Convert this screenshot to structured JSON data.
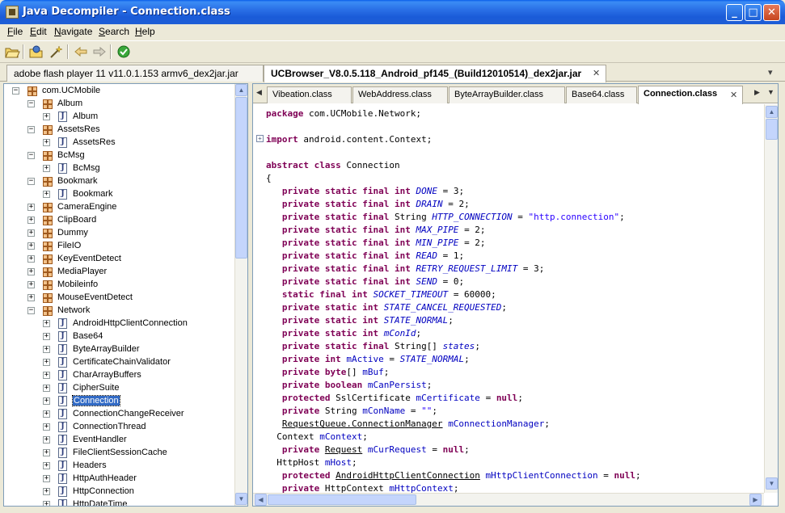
{
  "window": {
    "title": "Java Decompiler - Connection.class",
    "minimize": "_",
    "maximize": "□",
    "close": "✕"
  },
  "menu": {
    "items": [
      {
        "first": "F",
        "rest": "ile"
      },
      {
        "first": "E",
        "rest": "dit"
      },
      {
        "first": "N",
        "rest": "avigate"
      },
      {
        "first": "S",
        "rest": "earch"
      },
      {
        "first": "H",
        "rest": "elp"
      }
    ]
  },
  "toolbar": {
    "icons": [
      "open-folder-icon",
      "open-type-icon",
      "wand-icon",
      "back-arrow-icon",
      "forward-arrow-icon",
      "about-icon"
    ]
  },
  "jar_tabs": [
    {
      "label": "adobe flash player 11 v11.0.1.153 armv6_dex2jar.jar",
      "active": false
    },
    {
      "label": "UCBrowser_V8.0.5.118_Android_pf145_(Build12010514)_dex2jar.jar",
      "active": true
    }
  ],
  "tab_close": "✕",
  "tab_menu": "▾",
  "tree": {
    "expand": "+",
    "collapse": "−",
    "class_glyph": "J",
    "items": [
      {
        "label": "com.UCMobile",
        "type": "package",
        "level": 0,
        "state": "open"
      },
      {
        "label": "Album",
        "type": "package",
        "level": 1,
        "state": "open"
      },
      {
        "label": "Album",
        "type": "class",
        "level": 2,
        "state": "closed"
      },
      {
        "label": "AssetsRes",
        "type": "package",
        "level": 1,
        "state": "open"
      },
      {
        "label": "AssetsRes",
        "type": "class",
        "level": 2,
        "state": "closed"
      },
      {
        "label": "BcMsg",
        "type": "package",
        "level": 1,
        "state": "open"
      },
      {
        "label": "BcMsg",
        "type": "class",
        "level": 2,
        "state": "closed"
      },
      {
        "label": "Bookmark",
        "type": "package",
        "level": 1,
        "state": "open"
      },
      {
        "label": "Bookmark",
        "type": "class",
        "level": 2,
        "state": "closed"
      },
      {
        "label": "CameraEngine",
        "type": "package",
        "level": 1,
        "state": "closed"
      },
      {
        "label": "ClipBoard",
        "type": "package",
        "level": 1,
        "state": "closed"
      },
      {
        "label": "Dummy",
        "type": "package",
        "level": 1,
        "state": "closed"
      },
      {
        "label": "FileIO",
        "type": "package",
        "level": 1,
        "state": "closed"
      },
      {
        "label": "KeyEventDetect",
        "type": "package",
        "level": 1,
        "state": "closed"
      },
      {
        "label": "MediaPlayer",
        "type": "package",
        "level": 1,
        "state": "closed"
      },
      {
        "label": "Mobileinfo",
        "type": "package",
        "level": 1,
        "state": "closed"
      },
      {
        "label": "MouseEventDetect",
        "type": "package",
        "level": 1,
        "state": "closed"
      },
      {
        "label": "Network",
        "type": "package",
        "level": 1,
        "state": "open"
      },
      {
        "label": "AndroidHttpClientConnection",
        "type": "class",
        "level": 2,
        "state": "closed"
      },
      {
        "label": "Base64",
        "type": "class",
        "level": 2,
        "state": "closed"
      },
      {
        "label": "ByteArrayBuilder",
        "type": "class",
        "level": 2,
        "state": "closed"
      },
      {
        "label": "CertificateChainValidator",
        "type": "class",
        "level": 2,
        "state": "closed"
      },
      {
        "label": "CharArrayBuffers",
        "type": "class",
        "level": 2,
        "state": "closed"
      },
      {
        "label": "CipherSuite",
        "type": "class",
        "level": 2,
        "state": "closed"
      },
      {
        "label": "Connection",
        "type": "class",
        "level": 2,
        "state": "closed",
        "selected": true
      },
      {
        "label": "ConnectionChangeReceiver",
        "type": "class",
        "level": 2,
        "state": "closed"
      },
      {
        "label": "ConnectionThread",
        "type": "class",
        "level": 2,
        "state": "closed"
      },
      {
        "label": "EventHandler",
        "type": "class",
        "level": 2,
        "state": "closed"
      },
      {
        "label": "FileClientSessionCache",
        "type": "class",
        "level": 2,
        "state": "closed"
      },
      {
        "label": "Headers",
        "type": "class",
        "level": 2,
        "state": "closed"
      },
      {
        "label": "HttpAuthHeader",
        "type": "class",
        "level": 2,
        "state": "closed"
      },
      {
        "label": "HttpConnection",
        "type": "class",
        "level": 2,
        "state": "closed"
      },
      {
        "label": "HttpDateTime",
        "type": "class",
        "level": 2,
        "state": "closed"
      }
    ]
  },
  "class_tabs": [
    {
      "label": "Vibeation.class",
      "active": false
    },
    {
      "label": "WebAddress.class",
      "active": false
    },
    {
      "label": "ByteArrayBuilder.class",
      "active": false
    },
    {
      "label": "Base64.class",
      "active": false
    },
    {
      "label": "Connection.class",
      "active": true
    }
  ],
  "scroll_glyphs": {
    "up": "▲",
    "down": "▼",
    "left": "◀",
    "right": "▶",
    "tab_left": "◀",
    "tab_right": "▶"
  },
  "fold_marker": "+",
  "code": [
    [
      [
        "kw",
        "package"
      ],
      [
        "",
        "com.UCMobile.Network;"
      ]
    ],
    [],
    [
      [
        "kw",
        "import"
      ],
      [
        "",
        "android.content.Context;"
      ]
    ],
    [],
    [
      [
        "kw",
        "abstract class"
      ],
      [
        "",
        "Connection"
      ]
    ],
    [
      [
        "",
        "{"
      ]
    ],
    [
      [
        "",
        "  "
      ],
      [
        "kw",
        "private static final int"
      ],
      [
        "it",
        "DONE"
      ],
      [
        "",
        "= 3;"
      ]
    ],
    [
      [
        "",
        "  "
      ],
      [
        "kw",
        "private static final int"
      ],
      [
        "it",
        "DRAIN"
      ],
      [
        "",
        "= 2;"
      ]
    ],
    [
      [
        "",
        "  "
      ],
      [
        "kw",
        "private static final"
      ],
      [
        "",
        "String"
      ],
      [
        "it",
        "HTTP_CONNECTION"
      ],
      [
        "",
        "="
      ],
      [
        "str",
        "\"http.connection\""
      ],
      [
        "",
        ";"
      ]
    ],
    [
      [
        "",
        "  "
      ],
      [
        "kw",
        "private static final int"
      ],
      [
        "it",
        "MAX_PIPE"
      ],
      [
        "",
        "= 2;"
      ]
    ],
    [
      [
        "",
        "  "
      ],
      [
        "kw",
        "private static final int"
      ],
      [
        "it",
        "MIN_PIPE"
      ],
      [
        "",
        "= 2;"
      ]
    ],
    [
      [
        "",
        "  "
      ],
      [
        "kw",
        "private static final int"
      ],
      [
        "it",
        "READ"
      ],
      [
        "",
        "= 1;"
      ]
    ],
    [
      [
        "",
        "  "
      ],
      [
        "kw",
        "private static final int"
      ],
      [
        "it",
        "RETRY_REQUEST_LIMIT"
      ],
      [
        "",
        "= 3;"
      ]
    ],
    [
      [
        "",
        "  "
      ],
      [
        "kw",
        "private static final int"
      ],
      [
        "it",
        "SEND"
      ],
      [
        "",
        "= 0;"
      ]
    ],
    [
      [
        "",
        "  "
      ],
      [
        "kw",
        "static final int"
      ],
      [
        "it",
        "SOCKET_TIMEOUT"
      ],
      [
        "",
        "= 60000;"
      ]
    ],
    [
      [
        "",
        "  "
      ],
      [
        "kw",
        "private static int"
      ],
      [
        "it",
        "STATE_CANCEL_REQUESTED"
      ],
      [
        "",
        ";"
      ]
    ],
    [
      [
        "",
        "  "
      ],
      [
        "kw",
        "private static int"
      ],
      [
        "it",
        "STATE_NORMAL"
      ],
      [
        "",
        ";"
      ]
    ],
    [
      [
        "",
        "  "
      ],
      [
        "kw",
        "private static int"
      ],
      [
        "it",
        "mConId"
      ],
      [
        "",
        ";"
      ]
    ],
    [
      [
        "",
        "  "
      ],
      [
        "kw",
        "private static final"
      ],
      [
        "",
        "String[]"
      ],
      [
        "it",
        "states"
      ],
      [
        "",
        ";"
      ]
    ],
    [
      [
        "",
        "  "
      ],
      [
        "kw",
        "private int"
      ],
      [
        "fld",
        "mActive"
      ],
      [
        "",
        "="
      ],
      [
        "it",
        "STATE_NORMAL"
      ],
      [
        "",
        ";"
      ]
    ],
    [
      [
        "",
        "  "
      ],
      [
        "kw",
        "private byte"
      ],
      [
        "",
        "[]"
      ],
      [
        "fld",
        "mBuf"
      ],
      [
        "",
        ";"
      ]
    ],
    [
      [
        "",
        "  "
      ],
      [
        "kw",
        "private boolean"
      ],
      [
        "fld",
        "mCanPersist"
      ],
      [
        "",
        ";"
      ]
    ],
    [
      [
        "",
        "  "
      ],
      [
        "kw",
        "protected"
      ],
      [
        "",
        "SslCertificate"
      ],
      [
        "fld",
        "mCertificate"
      ],
      [
        "",
        "="
      ],
      [
        "kw",
        "null"
      ],
      [
        "",
        ";"
      ]
    ],
    [
      [
        "",
        "  "
      ],
      [
        "kw",
        "private"
      ],
      [
        "",
        "String"
      ],
      [
        "fld",
        "mConName"
      ],
      [
        "",
        "="
      ],
      [
        "str",
        "\"\""
      ],
      [
        "",
        ";"
      ]
    ],
    [
      [
        "",
        "  "
      ],
      [
        "lnk",
        "RequestQueue.ConnectionManager"
      ],
      [
        "fld",
        "mConnectionManager"
      ],
      [
        "",
        ";"
      ]
    ],
    [
      [
        "",
        "  Context"
      ],
      [
        "fld",
        "mContext"
      ],
      [
        "",
        ";"
      ]
    ],
    [
      [
        "",
        "  "
      ],
      [
        "kw",
        "private"
      ],
      [
        "lnk",
        "Request"
      ],
      [
        "fld",
        "mCurRequest"
      ],
      [
        "",
        "="
      ],
      [
        "kw",
        "null"
      ],
      [
        "",
        ";"
      ]
    ],
    [
      [
        "",
        "  HttpHost"
      ],
      [
        "fld",
        "mHost"
      ],
      [
        "",
        ";"
      ]
    ],
    [
      [
        "",
        "  "
      ],
      [
        "kw",
        "protected"
      ],
      [
        "lnk",
        "AndroidHttpClientConnection"
      ],
      [
        "fld",
        "mHttpClientConnection"
      ],
      [
        "",
        "="
      ],
      [
        "kw",
        "null"
      ],
      [
        "",
        ";"
      ]
    ],
    [
      [
        "",
        "  "
      ],
      [
        "kw",
        "private"
      ],
      [
        "",
        "HttpContext"
      ],
      [
        "fld",
        "mHttpContext"
      ],
      [
        "",
        ";"
      ]
    ]
  ]
}
